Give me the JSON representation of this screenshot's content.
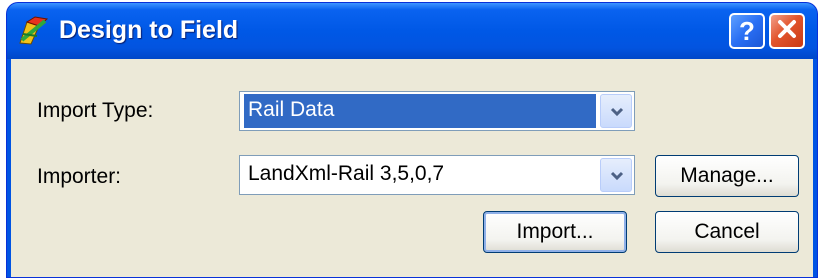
{
  "window": {
    "title": "Design to Field"
  },
  "form": {
    "import_type_label": "Import Type:",
    "import_type_value": "Rail Data",
    "importer_label": "Importer:",
    "importer_value": "LandXml-Rail 3,5,0,7"
  },
  "buttons": {
    "manage_label": "Manage...",
    "import_label": "Import...",
    "cancel_label": "Cancel"
  },
  "icons": {
    "title": "app-icon",
    "help": "help-icon",
    "close": "close-icon",
    "dropdown": "chevron-down-icon"
  },
  "colors": {
    "titlebar": "#0058e6",
    "selection": "#316ac5",
    "client_bg": "#ece9d8",
    "close_button": "#e2552d"
  }
}
